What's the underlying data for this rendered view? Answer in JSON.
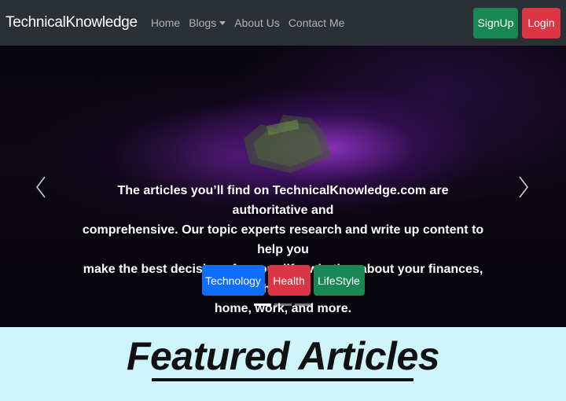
{
  "navbar": {
    "brand": "TechnicalKnowledge",
    "links": [
      "Home",
      "Blogs",
      "About Us",
      "Contact Me"
    ],
    "signup_label": "SignUp",
    "login_label": "Login"
  },
  "carousel": {
    "caption_lines": [
      "The articles you’ll find on TechnicalKnowledge.com are authoritative and",
      "comprehensive. Our topic experts research and write up content to help you",
      "make the best decisions for your life, whether about your finances, health,",
      "home, work, and more."
    ],
    "tags": [
      "Technology",
      "Health",
      "LifeStyle"
    ],
    "indicator_count": 3,
    "active_indicator": 1
  },
  "featured": {
    "title": "Featured Articles"
  },
  "colors": {
    "navbar_bg": "#2b3035",
    "success": "#198754",
    "danger": "#dc3545",
    "primary": "#0d6efd",
    "featured_bg": "#cff4fc"
  }
}
